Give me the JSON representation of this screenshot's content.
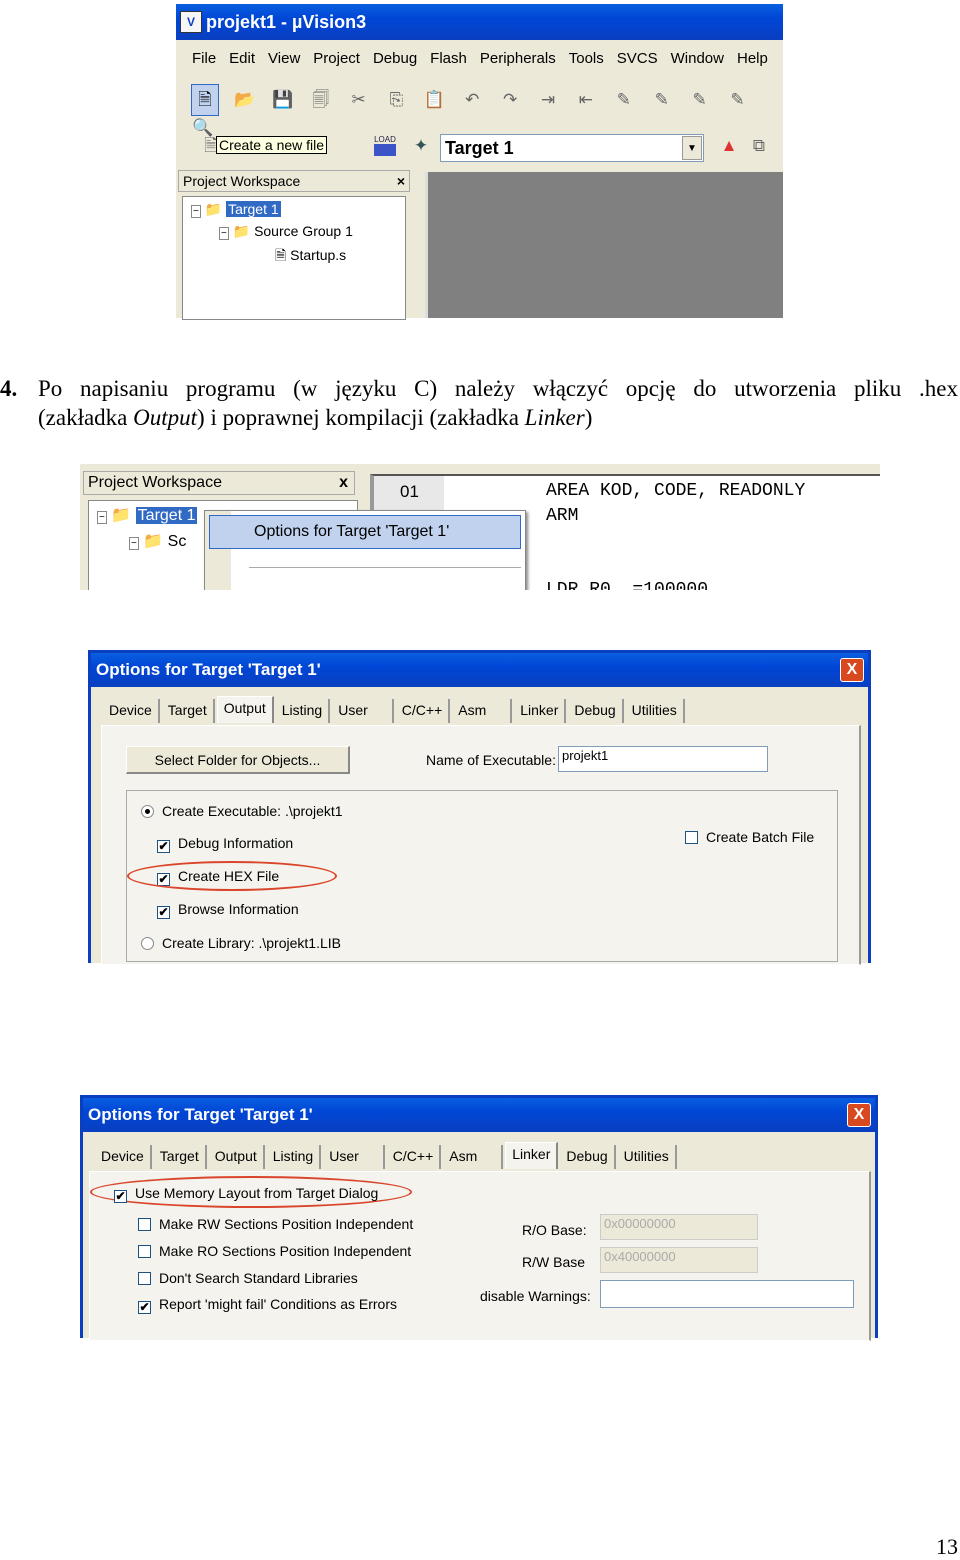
{
  "shot1": {
    "title": "projekt1  - µVision3",
    "menu": [
      "File",
      "Edit",
      "View",
      "Project",
      "Debug",
      "Flash",
      "Peripherals",
      "Tools",
      "SVCS",
      "Window",
      "Help"
    ],
    "tooltip": "Create a new file",
    "load_label": "LOAD",
    "target_select": "Target 1",
    "workspace_title": "Project Workspace",
    "close_glyph": "×",
    "tree": {
      "target": "Target 1",
      "group": "Source Group 1",
      "file": "Startup.s"
    }
  },
  "paragraph": {
    "number": "4.",
    "line1": "Po napisaniu programu (w języku C) należy włączyć opcję do utworzenia pliku .hex",
    "line2_a": "(zakładka ",
    "line2_b": "Output",
    "line2_c": ") i poprawnej kompilacji (zakładka ",
    "line2_d": "Linker",
    "line2_e": ")"
  },
  "shot2": {
    "workspace_title": "Project Workspace",
    "close_glyph": "x",
    "tree_target": "Target 1",
    "tree_group": "Sc",
    "context_item": "Options for Target 'Target 1'",
    "line_number": "01",
    "code": [
      "AREA KOD, CODE, READONLY",
      "ARM",
      "LDR R0, =100000"
    ]
  },
  "dialog1": {
    "title": "Options for Target 'Target 1'",
    "close_glyph": "X",
    "tabs": [
      "Device",
      "Target",
      "Output",
      "Listing",
      "User",
      "C/C++",
      "Asm",
      "Linker",
      "Debug",
      "Utilities"
    ],
    "active_tab": "Output",
    "select_folder_button": "Select Folder for Objects...",
    "name_label": "Name of Executable:",
    "name_value": "projekt1",
    "create_executable": "Create Executable:  .\\projekt1",
    "debug_info": "Debug Information",
    "create_hex": "Create HEX File",
    "browse_info": "Browse Information",
    "create_library": "Create Library:  .\\projekt1.LIB",
    "create_batch": "Create Batch File",
    "highlight_color": "#d9462c"
  },
  "dialog2": {
    "title": "Options for Target 'Target 1'",
    "close_glyph": "X",
    "tabs": [
      "Device",
      "Target",
      "Output",
      "Listing",
      "User",
      "C/C++",
      "Asm",
      "Linker",
      "Debug",
      "Utilities"
    ],
    "active_tab": "Linker",
    "use_memory_layout": "Use Memory Layout from Target Dialog",
    "make_rw": "Make RW Sections Position Independent",
    "make_ro": "Make RO Sections Position Independent",
    "dont_search": "Don't Search Standard Libraries",
    "report_fail": "Report 'might fail' Conditions as Errors",
    "ro_base_label": "R/O Base:",
    "ro_base_value": "0x00000000",
    "rw_base_label": "R/W Base",
    "rw_base_value": "0x40000000",
    "disable_warnings_label": "disable Warnings:",
    "disable_warnings_value": ""
  },
  "page_number": "13"
}
